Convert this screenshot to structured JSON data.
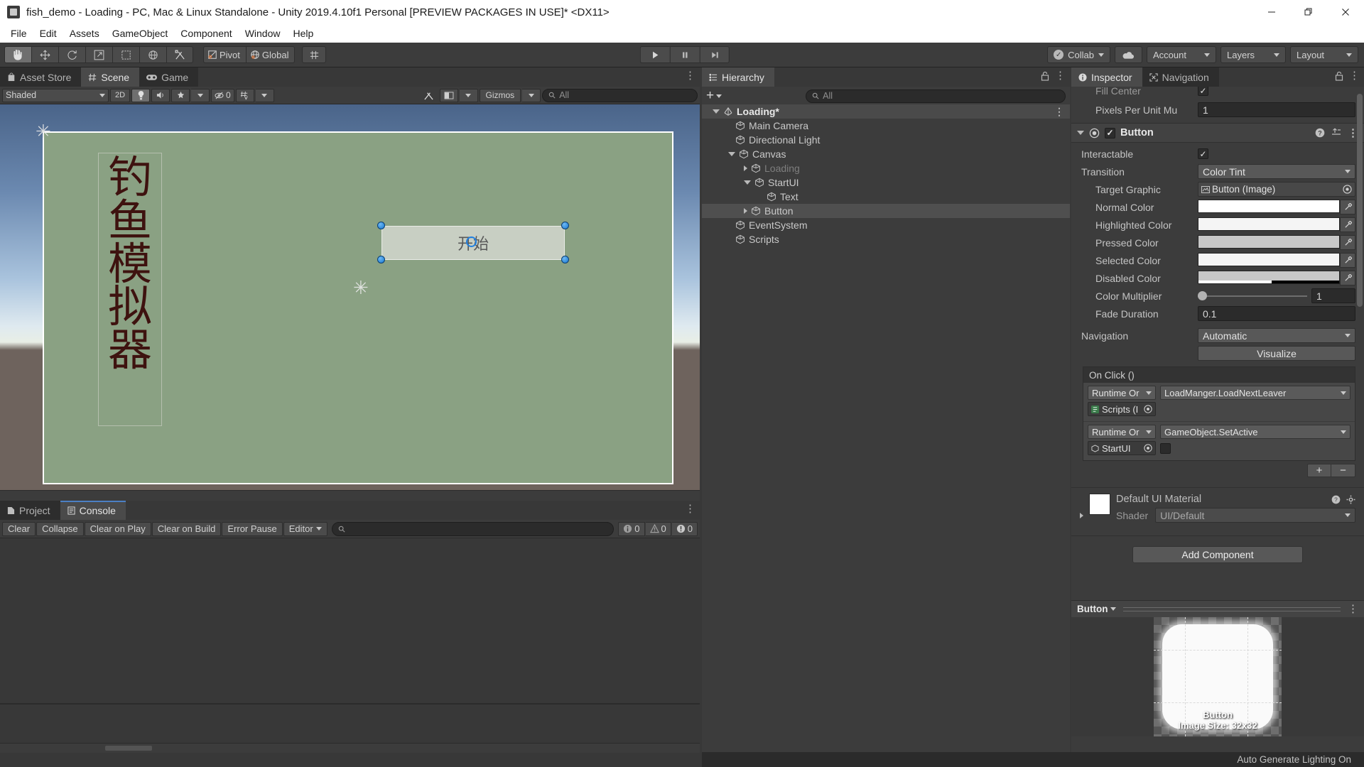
{
  "window": {
    "title": "fish_demo - Loading - PC, Mac & Linux Standalone - Unity 2019.4.10f1 Personal [PREVIEW PACKAGES IN USE]* <DX11>",
    "minimize": "—",
    "maximize": "❐",
    "close": "✕"
  },
  "menubar": {
    "items": [
      "File",
      "Edit",
      "Assets",
      "GameObject",
      "Component",
      "Window",
      "Help"
    ]
  },
  "toolbar": {
    "tools": [
      "hand-tool",
      "move-tool",
      "rotate-tool",
      "scale-tool",
      "rect-tool",
      "transform-tool",
      "custom-tool"
    ],
    "pivot_label": "Pivot",
    "global_label": "Global",
    "grid_label": "grid-snap-icon",
    "play": "play-button",
    "pause": "pause-button",
    "step": "step-button",
    "collab_label": "Collab",
    "cloud_label": "cloud-icon",
    "account_label": "Account",
    "layers_label": "Layers",
    "layout_label": "Layout"
  },
  "scene": {
    "tabs": [
      {
        "label": "Asset Store",
        "icon": "store-icon",
        "active": false
      },
      {
        "label": "Scene",
        "icon": "grid-icon",
        "active": true
      },
      {
        "label": "Game",
        "icon": "gamepad-icon",
        "active": false
      }
    ],
    "shading_mode": "Shaded",
    "mode_2d": "2D",
    "lighting": "lighting-icon",
    "audio": "audio-icon",
    "fx": "fx-icon",
    "hidden_count": "0",
    "grid": "grid-visibility-icon",
    "gizmos_label": "Gizmos",
    "search_placeholder": "All",
    "content": {
      "vertical_title": [
        "钓",
        "鱼",
        "模",
        "拟",
        "器"
      ],
      "start_button_label": "开始"
    }
  },
  "console": {
    "tabs": [
      {
        "label": "Project",
        "icon": "folder-icon",
        "active": false
      },
      {
        "label": "Console",
        "icon": "console-icon",
        "active": true
      }
    ],
    "buttons": [
      "Clear",
      "Collapse",
      "Clear on Play",
      "Clear on Build",
      "Error Pause"
    ],
    "editor_dropdown": "Editor",
    "search_placeholder": "",
    "counts": {
      "log": "0",
      "warning": "0",
      "error": "0"
    }
  },
  "hierarchy": {
    "tab_label": "Hierarchy",
    "search_placeholder": "All",
    "create_label": "+",
    "items": [
      {
        "label": "Loading*",
        "depth": 0,
        "icon": "scene-icon",
        "arrow": "open",
        "selected_row": true,
        "dim": false,
        "kebab": true
      },
      {
        "label": "Main Camera",
        "depth": 1,
        "icon": "gameobject-icon",
        "arrow": "none",
        "selected_row": false,
        "dim": false,
        "kebab": false
      },
      {
        "label": "Directional Light",
        "depth": 1,
        "icon": "gameobject-icon",
        "arrow": "none",
        "selected_row": false,
        "dim": false,
        "kebab": false
      },
      {
        "label": "Canvas",
        "depth": 1,
        "icon": "gameobject-icon",
        "arrow": "open",
        "selected_row": false,
        "dim": false,
        "kebab": false
      },
      {
        "label": "Loading",
        "depth": 2,
        "icon": "gameobject-icon",
        "arrow": "closed",
        "selected_row": false,
        "dim": true,
        "kebab": false
      },
      {
        "label": "StartUI",
        "depth": 2,
        "icon": "gameobject-icon",
        "arrow": "open",
        "selected_row": false,
        "dim": false,
        "kebab": false
      },
      {
        "label": "Text",
        "depth": 3,
        "icon": "gameobject-icon",
        "arrow": "none",
        "selected_row": false,
        "dim": false,
        "kebab": false
      },
      {
        "label": "Button",
        "depth": 2,
        "icon": "gameobject-icon",
        "arrow": "closed",
        "selected_row": true,
        "dim": false,
        "kebab": false
      },
      {
        "label": "EventSystem",
        "depth": 1,
        "icon": "gameobject-icon",
        "arrow": "none",
        "selected_row": false,
        "dim": false,
        "kebab": false
      },
      {
        "label": "Scripts",
        "depth": 1,
        "icon": "gameobject-icon",
        "arrow": "none",
        "selected_row": false,
        "dim": false,
        "kebab": false
      }
    ]
  },
  "inspector": {
    "tabs": [
      {
        "label": "Inspector",
        "icon": "info-icon",
        "active": true
      },
      {
        "label": "Navigation",
        "icon": "navigation-icon",
        "active": false
      }
    ],
    "clipped_top": {
      "fill_center_label": "Fill Center",
      "pixels_per_unit_label": "Pixels Per Unit Mu",
      "pixels_per_unit_value": "1"
    },
    "component": {
      "name": "Button",
      "enabled": true,
      "rows": [
        {
          "label": "Interactable",
          "type": "checkbox",
          "value": "true",
          "indent": false
        },
        {
          "label": "Transition",
          "type": "dropdown",
          "value": "Color Tint",
          "indent": false
        },
        {
          "label": "Target Graphic",
          "type": "object",
          "value": "Button (Image)",
          "indent": true
        },
        {
          "label": "Normal Color",
          "type": "color",
          "value": "#FFFFFF",
          "indent": true
        },
        {
          "label": "Highlighted Color",
          "type": "color",
          "value": "#F5F5F5",
          "indent": true
        },
        {
          "label": "Pressed Color",
          "type": "color",
          "value": "#C8C8C8",
          "indent": true
        },
        {
          "label": "Selected Color",
          "type": "color",
          "value": "#F5F5F5",
          "indent": true
        },
        {
          "label": "Disabled Color",
          "type": "color",
          "value": "#C8C8C8",
          "indent": true
        },
        {
          "label": "Color Multiplier",
          "type": "slider",
          "value": "1",
          "indent": true
        },
        {
          "label": "Fade Duration",
          "type": "text",
          "value": "0.1",
          "indent": true
        },
        {
          "label": "Navigation",
          "type": "dropdown",
          "value": "Automatic",
          "indent": false
        }
      ],
      "visualize_label": "Visualize"
    },
    "onclick": {
      "header": "On Click ()",
      "entries": [
        {
          "mode": "Runtime Or",
          "method": "LoadManger.LoadNextLeaver",
          "object": "Scripts (I",
          "object_icon": "script-icon",
          "extra": null
        },
        {
          "mode": "Runtime Or",
          "method": "GameObject.SetActive",
          "object": "StartUI",
          "object_icon": "gameobject-icon",
          "extra": "checkbox"
        }
      ],
      "add_label": "+",
      "remove_label": "−"
    },
    "material": {
      "name": "Default UI Material",
      "shader_label": "Shader",
      "shader_value": "UI/Default"
    },
    "add_component_label": "Add Component",
    "preview": {
      "name": "Button",
      "caption_name": "Button",
      "caption_size": "Image Size: 32x32"
    }
  },
  "statusbar": {
    "message": "Auto Generate Lighting On"
  }
}
